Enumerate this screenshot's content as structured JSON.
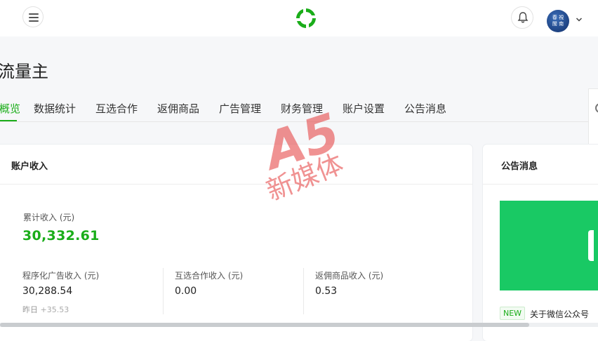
{
  "header": {
    "menu_icon": "hamburger-menu-icon",
    "logo_icon": "wechat-pay-swirl-logo",
    "bell_icon": "bell-icon",
    "avatar_text": [
      "春",
      "視",
      "閩",
      "南"
    ],
    "dropdown_icon": "chevron-down-icon"
  },
  "page": {
    "title": "流量主"
  },
  "tabs": [
    {
      "label": "概览",
      "active": true
    },
    {
      "label": "数据统计"
    },
    {
      "label": "互选合作"
    },
    {
      "label": "返佣商品"
    },
    {
      "label": "广告管理"
    },
    {
      "label": "财务管理"
    },
    {
      "label": "账户设置"
    },
    {
      "label": "公告消息"
    }
  ],
  "income": {
    "title": "账户收入",
    "total_label": "累计收入 (元)",
    "total_value": "30,332.61",
    "metrics": [
      {
        "label": "程序化广告收入 (元)",
        "value": "30,288.54",
        "sub_label": "昨日",
        "sub_delta": "+35.53"
      },
      {
        "label": "互选合作收入 (元)",
        "value": "0.00"
      },
      {
        "label": "返佣商品收入 (元)",
        "value": "0.53"
      }
    ]
  },
  "notice": {
    "title": "公告消息",
    "badge": "NEW",
    "item_text": "关于微信公众号"
  },
  "watermark": {
    "text": "新媒体",
    "mark": "A5"
  },
  "colors": {
    "accent": "#1aad19",
    "banner": "#19c964",
    "watermark": "#e43a3a"
  }
}
